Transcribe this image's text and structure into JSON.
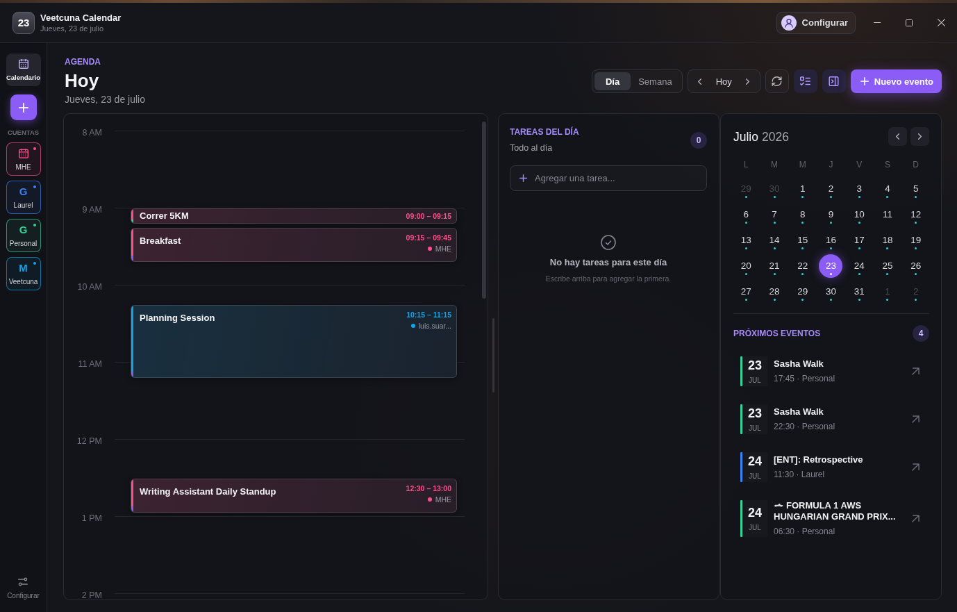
{
  "window": {
    "logo": "23",
    "title": "Veetcuna Calendar",
    "subtitle": "Jueves, 23 de julio",
    "profile_button": "Configurar"
  },
  "sidebar": {
    "nav": [
      {
        "label": "Calendario",
        "selected": true
      }
    ],
    "section_title": "CUENTAS",
    "accounts": [
      {
        "kind": "calendar",
        "label": "MHE",
        "color": "#ff4f8b"
      },
      {
        "kind": "letter",
        "letter": "G",
        "label": "Laurel",
        "color": "#3b82f6"
      },
      {
        "kind": "letter",
        "letter": "G",
        "label": "Personal",
        "color": "#34d399"
      },
      {
        "kind": "letter",
        "letter": "M",
        "label": "Veetcuna",
        "color": "#0ea5e9"
      }
    ],
    "footer_button": "Configurar"
  },
  "header": {
    "eyebrow": "AGENDA",
    "title": "Hoy",
    "date": "Jueves, 23 de julio"
  },
  "toolbar": {
    "views": [
      {
        "label": "Día",
        "selected": true
      },
      {
        "label": "Semana",
        "selected": false
      }
    ],
    "today_button": "Hoy",
    "toggles": [
      {
        "kind": "tasks",
        "on": true
      },
      {
        "kind": "panel",
        "on": true
      }
    ],
    "new_event_button": "Nuevo evento"
  },
  "day_view": {
    "hours": [
      "8 AM",
      "9 AM",
      "10 AM",
      "11 AM",
      "12 PM",
      "1 PM",
      "2 PM"
    ],
    "events": [
      {
        "title": "Correr 5KM",
        "time": "09:00 – 09:15",
        "color": "#ff4f8b",
        "accent": {
          "color": "#34d399"
        }
      },
      {
        "title": "Breakfast",
        "time": "09:15 – 09:45",
        "account": "MHE",
        "color": "#ff4f8b",
        "accent": {
          "color": "#8b5cf6"
        }
      },
      {
        "title": "Planning Session",
        "time": "10:15 – 11:15",
        "account": "luis.suar...",
        "color": "#0ea5e9",
        "accent": {
          "color": "#8b5cf6"
        }
      },
      {
        "title": "Writing Assistant Daily Standup",
        "time": "12:30 – 13:00",
        "account": "MHE",
        "color": "#ff4f8b",
        "accent": {
          "color": "#8b5cf6"
        }
      }
    ]
  },
  "tasks": {
    "title": "TAREAS DEL DÍA",
    "subtitle": "Todo al día",
    "count": "0",
    "placeholder": "Agregar una tarea...",
    "empty_title": "No hay tareas para este día",
    "empty_hint": "Escribe arriba para agregar la primera."
  },
  "mini_calendar": {
    "month": "Julio",
    "year": "2026",
    "weekdays": [
      "L",
      "M",
      "M",
      "J",
      "V",
      "S",
      "D"
    ],
    "days": [
      {
        "label": "29",
        "outside": true,
        "has_events": true,
        "selected": false
      },
      {
        "label": "30",
        "outside": true,
        "has_events": true,
        "selected": false
      },
      {
        "label": "1",
        "outside": false,
        "has_events": true,
        "selected": false
      },
      {
        "label": "2",
        "outside": false,
        "has_events": true,
        "selected": false
      },
      {
        "label": "3",
        "outside": false,
        "has_events": true,
        "selected": false
      },
      {
        "label": "4",
        "outside": false,
        "has_events": true,
        "selected": false
      },
      {
        "label": "5",
        "outside": false,
        "has_events": true,
        "selected": false
      },
      {
        "label": "6",
        "outside": false,
        "has_events": true,
        "selected": false
      },
      {
        "label": "7",
        "outside": false,
        "has_events": true,
        "selected": false
      },
      {
        "label": "8",
        "outside": false,
        "has_events": true,
        "selected": false
      },
      {
        "label": "9",
        "outside": false,
        "has_events": true,
        "selected": false
      },
      {
        "label": "10",
        "outside": false,
        "has_events": true,
        "selected": false
      },
      {
        "label": "11",
        "outside": false,
        "has_events": false,
        "selected": false
      },
      {
        "label": "12",
        "outside": false,
        "has_events": true,
        "selected": false
      },
      {
        "label": "13",
        "outside": false,
        "has_events": true,
        "selected": false
      },
      {
        "label": "14",
        "outside": false,
        "has_events": true,
        "selected": false
      },
      {
        "label": "15",
        "outside": false,
        "has_events": true,
        "selected": false
      },
      {
        "label": "16",
        "outside": false,
        "has_events": true,
        "selected": false
      },
      {
        "label": "17",
        "outside": false,
        "has_events": true,
        "selected": false
      },
      {
        "label": "18",
        "outside": false,
        "has_events": true,
        "selected": false
      },
      {
        "label": "19",
        "outside": false,
        "has_events": true,
        "selected": false
      },
      {
        "label": "20",
        "outside": false,
        "has_events": true,
        "selected": false
      },
      {
        "label": "21",
        "outside": false,
        "has_events": true,
        "selected": false
      },
      {
        "label": "22",
        "outside": false,
        "has_events": true,
        "selected": false
      },
      {
        "label": "23",
        "outside": false,
        "has_events": true,
        "selected": true
      },
      {
        "label": "24",
        "outside": false,
        "has_events": true,
        "selected": false
      },
      {
        "label": "25",
        "outside": false,
        "has_events": true,
        "selected": false
      },
      {
        "label": "26",
        "outside": false,
        "has_events": true,
        "selected": false
      },
      {
        "label": "27",
        "outside": false,
        "has_events": true,
        "selected": false
      },
      {
        "label": "28",
        "outside": false,
        "has_events": true,
        "selected": false
      },
      {
        "label": "29",
        "outside": false,
        "has_events": true,
        "selected": false
      },
      {
        "label": "30",
        "outside": false,
        "has_events": true,
        "selected": false
      },
      {
        "label": "31",
        "outside": false,
        "has_events": true,
        "selected": false
      },
      {
        "label": "1",
        "outside": true,
        "has_events": true,
        "selected": false
      },
      {
        "label": "2",
        "outside": true,
        "has_events": true,
        "selected": false
      }
    ]
  },
  "upcoming": {
    "title": "PRÓXIMOS EVENTOS",
    "count": "4",
    "items": [
      {
        "day": "23",
        "month": "JUL",
        "title": "Sasha Walk",
        "meta": "17:45 · Personal",
        "color": "#34d399",
        "leading_icon": false
      },
      {
        "day": "23",
        "month": "JUL",
        "title": "Sasha Walk",
        "meta": "22:30 · Personal",
        "color": "#34d399",
        "leading_icon": false
      },
      {
        "day": "24",
        "month": "JUL",
        "title": "[ENT]: Retrospective",
        "meta": "11:30 · Laurel",
        "color": "#3b82f6",
        "leading_icon": false
      },
      {
        "day": "24",
        "month": "JUL",
        "title": "FORMULA 1 AWS HUNGARIAN GRAND PRIX...",
        "meta": "06:30 · Personal",
        "color": "#34d399",
        "leading_icon": true
      }
    ]
  }
}
